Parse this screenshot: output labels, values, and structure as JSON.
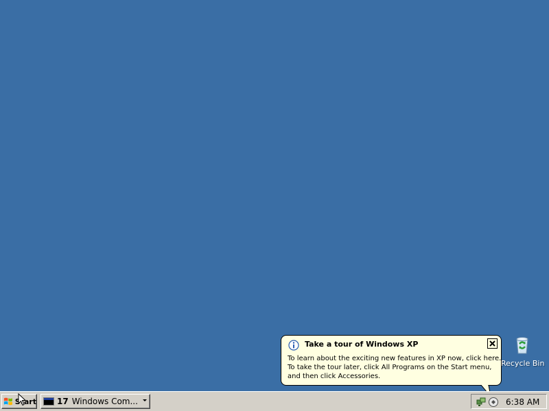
{
  "desktop": {
    "background_color": "#3a6ea5",
    "icons": [
      {
        "label": "Recycle Bin",
        "icon": "recycle-bin-icon"
      }
    ]
  },
  "balloon": {
    "icon": "info-icon",
    "title": "Take a tour of Windows XP",
    "close_icon": "close-icon",
    "lines": [
      "To learn about the exciting new features in XP now, click here.",
      "To take the tour later, click All Programs on the Start menu,",
      "and then click Accessories."
    ],
    "background_color": "#ffffe1"
  },
  "taskbar": {
    "start_label": "Start",
    "start_icon": "windows-flag-icon",
    "task_button": {
      "count": "17",
      "label": "Windows Com...",
      "icon": "command-prompt-icon"
    },
    "tray": {
      "icons": [
        "network-icon",
        "tour-icon"
      ],
      "clock": "6:38 AM"
    },
    "background_color": "#d4d0c8"
  }
}
